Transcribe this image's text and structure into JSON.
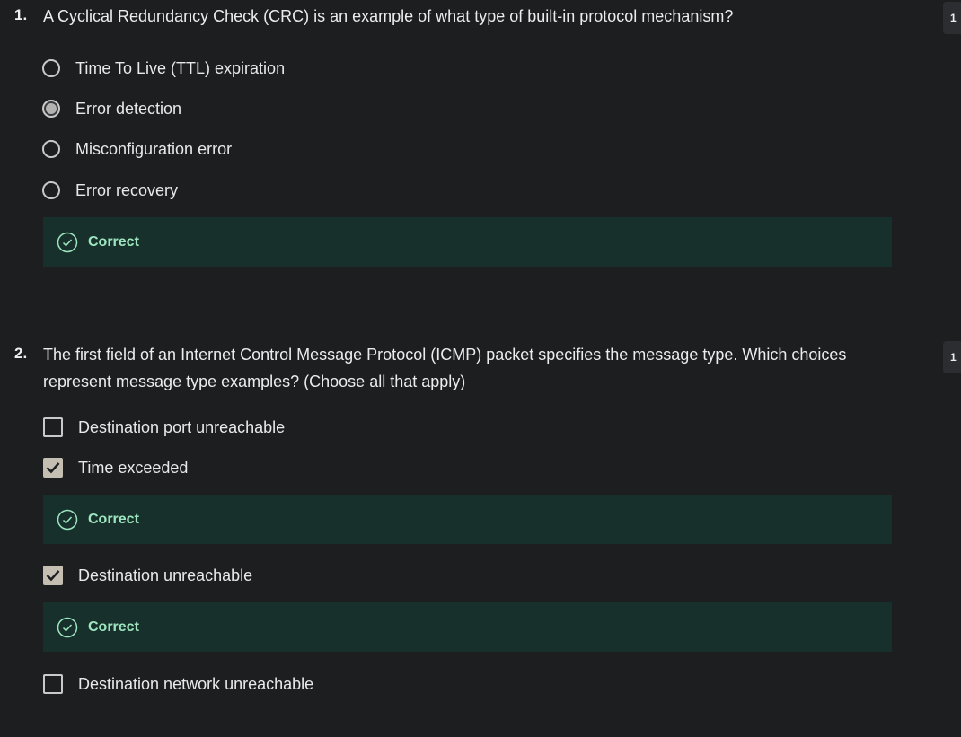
{
  "questions": [
    {
      "number": "1.",
      "text": "A Cyclical Redundancy Check (CRC) is an example of what type of built-in protocol mechanism?",
      "points": "1",
      "type": "radio",
      "options": [
        {
          "label": "Time To Live (TTL) expiration",
          "selected": false
        },
        {
          "label": "Error detection",
          "selected": true
        },
        {
          "label": "Misconfiguration error",
          "selected": false
        },
        {
          "label": "Error recovery",
          "selected": false
        }
      ],
      "feedback": "Correct"
    },
    {
      "number": "2.",
      "text": "The first field of an Internet Control Message Protocol (ICMP) packet specifies the message type. Which choices represent message type examples? (Choose all that apply)",
      "points": "1",
      "type": "checkbox",
      "options": [
        {
          "label": "Destination port unreachable",
          "selected": false
        },
        {
          "label": "Time exceeded",
          "selected": true,
          "feedback": "Correct"
        },
        {
          "label": "Destination unreachable",
          "selected": true,
          "feedback": "Correct"
        },
        {
          "label": "Destination network unreachable",
          "selected": false
        }
      ]
    }
  ],
  "colors": {
    "background": "#1d1e20",
    "feedback_bg": "#17302b",
    "feedback_text": "#9ee6c0",
    "checked_fill": "#c4beb3"
  },
  "icons": {
    "feedback": "check-circle-icon",
    "checkbox_checked": "checkmark-icon"
  }
}
